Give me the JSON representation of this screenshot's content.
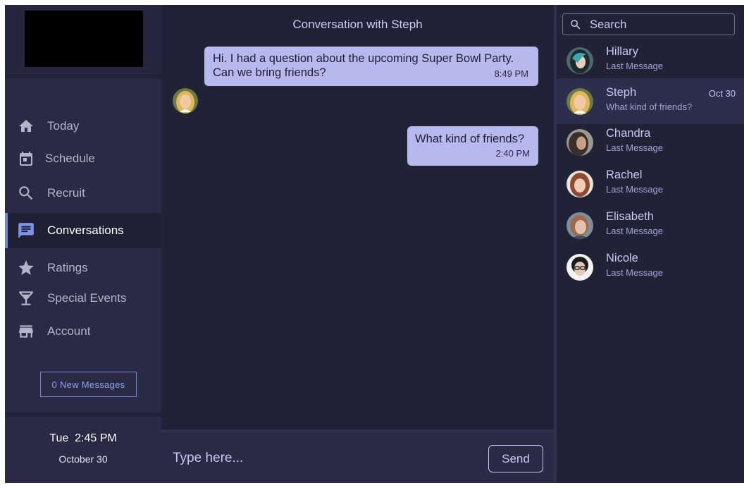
{
  "sidebar": {
    "nav": [
      {
        "label": "Today",
        "icon": "home-icon"
      },
      {
        "label": "Schedule",
        "icon": "calendar-icon"
      },
      {
        "label": "Recruit",
        "icon": "search-icon"
      },
      {
        "label": "Conversations",
        "icon": "chat-icon",
        "active": true
      },
      {
        "label": "Ratings",
        "icon": "star-icon"
      },
      {
        "label": "Special Events",
        "icon": "cocktail-icon"
      },
      {
        "label": "Account",
        "icon": "store-icon"
      }
    ],
    "new_messages_label": "0 New Messages",
    "clock": {
      "time": "Tue  2:45 PM",
      "date": "October 30"
    }
  },
  "conversation": {
    "title": "Conversation with Steph",
    "messages": [
      {
        "from": "me",
        "lines": [
          "Hi. I had a question about the upcoming Super Bowl Party.",
          "Can we bring friends?"
        ],
        "time": "8:49 PM"
      },
      {
        "from": "Steph",
        "lines": [
          "What kind of friends?"
        ],
        "time": "2:40 PM"
      }
    ],
    "input_placeholder": "Type here...",
    "send_label": "Send"
  },
  "contacts": {
    "search_placeholder": "Search",
    "items": [
      {
        "name": "Hillary",
        "message": "Last Message",
        "date": ""
      },
      {
        "name": "Steph",
        "message": "What kind of friends?",
        "date": "Oct 30",
        "selected": true
      },
      {
        "name": "Chandra",
        "message": "Last Message",
        "date": ""
      },
      {
        "name": "Rachel",
        "message": "Last Message",
        "date": ""
      },
      {
        "name": "Elisabeth",
        "message": "Last Message",
        "date": ""
      },
      {
        "name": "Nicole",
        "message": "Last Message",
        "date": ""
      }
    ]
  },
  "colors": {
    "background": "#212236",
    "sidebar": "#2a2a46",
    "bubble": "#b7b9ee",
    "accent": "#6f86d6",
    "text_light": "#c6c9f5"
  }
}
